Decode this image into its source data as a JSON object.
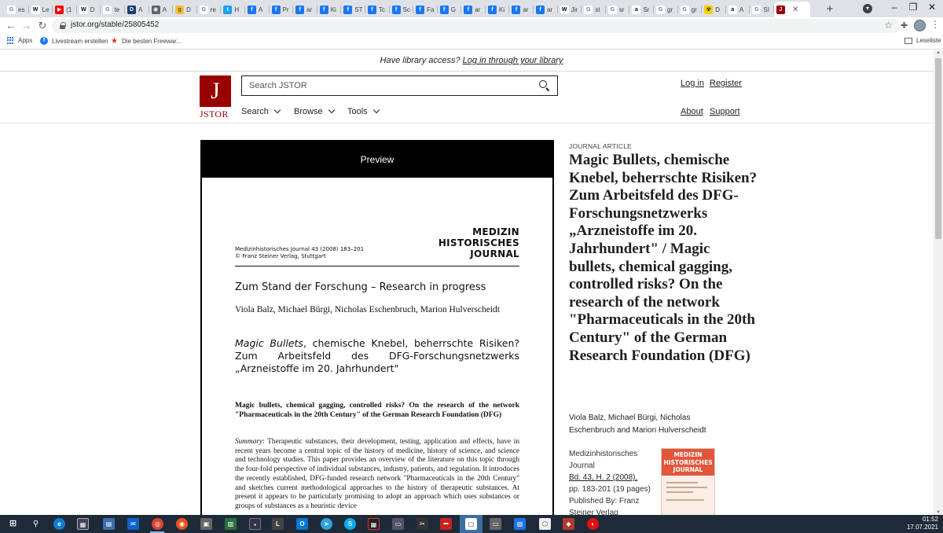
{
  "browser": {
    "tabs": [
      {
        "label": "es",
        "icon": "google-icon",
        "color": "#ffffff",
        "glyph": "G",
        "fg": "#4285f4"
      },
      {
        "label": "Le",
        "icon": "wikipedia-icon",
        "color": "#ffffff",
        "glyph": "W",
        "fg": "#000000"
      },
      {
        "label": "(1",
        "icon": "youtube-icon",
        "color": "#ff0000",
        "glyph": "▶",
        "fg": "#ffffff"
      },
      {
        "label": "D",
        "icon": "wikipedia-icon",
        "color": "#ffffff",
        "glyph": "W",
        "fg": "#000000"
      },
      {
        "label": "te",
        "icon": "google-icon",
        "color": "#ffffff",
        "glyph": "G",
        "fg": "#4285f4"
      },
      {
        "label": "A",
        "icon": "doc-icon",
        "color": "#1a3a6b",
        "glyph": "D",
        "fg": "#ffffff"
      },
      {
        "label": "A",
        "icon": "globe-icon",
        "color": "#5f6368",
        "glyph": "◉",
        "fg": "#ffffff"
      },
      {
        "label": "D",
        "icon": "site-icon",
        "color": "#f0c040",
        "glyph": "g",
        "fg": "#6b4a00"
      },
      {
        "label": "re",
        "icon": "google-icon",
        "color": "#ffffff",
        "glyph": "G",
        "fg": "#4285f4"
      },
      {
        "label": "H",
        "icon": "twitter-icon",
        "color": "#1da1f2",
        "glyph": "t",
        "fg": "#ffffff"
      },
      {
        "label": "A",
        "icon": "facebook-icon",
        "color": "#1877f2",
        "glyph": "f",
        "fg": "#ffffff"
      },
      {
        "label": "Pr",
        "icon": "facebook-icon",
        "color": "#1877f2",
        "glyph": "f",
        "fg": "#ffffff"
      },
      {
        "label": "ar",
        "icon": "facebook-icon",
        "color": "#1877f2",
        "glyph": "f",
        "fg": "#ffffff"
      },
      {
        "label": "Ki",
        "icon": "facebook-icon",
        "color": "#1877f2",
        "glyph": "f",
        "fg": "#ffffff"
      },
      {
        "label": "ST",
        "icon": "facebook-icon",
        "color": "#1877f2",
        "glyph": "f",
        "fg": "#ffffff"
      },
      {
        "label": "Tc",
        "icon": "facebook-icon",
        "color": "#1877f2",
        "glyph": "f",
        "fg": "#ffffff"
      },
      {
        "label": "Sc",
        "icon": "facebook-icon",
        "color": "#1877f2",
        "glyph": "f",
        "fg": "#ffffff"
      },
      {
        "label": "Fa",
        "icon": "facebook-icon",
        "color": "#1877f2",
        "glyph": "f",
        "fg": "#ffffff"
      },
      {
        "label": "G",
        "icon": "facebook-icon",
        "color": "#1877f2",
        "glyph": "f",
        "fg": "#ffffff"
      },
      {
        "label": "ar",
        "icon": "facebook-icon",
        "color": "#1877f2",
        "glyph": "f",
        "fg": "#ffffff"
      },
      {
        "label": "Ki",
        "icon": "facebook-icon",
        "color": "#1877f2",
        "glyph": "f",
        "fg": "#ffffff"
      },
      {
        "label": "ar",
        "icon": "facebook-icon",
        "color": "#1877f2",
        "glyph": "f",
        "fg": "#ffffff"
      },
      {
        "label": "ar",
        "icon": "facebook-icon",
        "color": "#1877f2",
        "glyph": "f",
        "fg": "#ffffff"
      },
      {
        "label": "Jir",
        "icon": "wikipedia-icon",
        "color": "#ffffff",
        "glyph": "W",
        "fg": "#000000"
      },
      {
        "label": "st",
        "icon": "google-icon",
        "color": "#ffffff",
        "glyph": "G",
        "fg": "#4285f4"
      },
      {
        "label": "sr",
        "icon": "google-icon",
        "color": "#ffffff",
        "glyph": "G",
        "fg": "#4285f4"
      },
      {
        "label": "Sr",
        "icon": "amazon-icon",
        "color": "#ffffff",
        "glyph": "a",
        "fg": "#111111"
      },
      {
        "label": "gr",
        "icon": "google-icon",
        "color": "#ffffff",
        "glyph": "G",
        "fg": "#4285f4"
      },
      {
        "label": "gr",
        "icon": "google-icon",
        "color": "#ffffff",
        "glyph": "G",
        "fg": "#4285f4"
      },
      {
        "label": "D",
        "icon": "radiation-icon",
        "color": "#f5d000",
        "glyph": "☢",
        "fg": "#111111"
      },
      {
        "label": "A",
        "icon": "amazon-icon",
        "color": "#ffffff",
        "glyph": "a",
        "fg": "#111111"
      },
      {
        "label": "SI",
        "icon": "google-icon",
        "color": "#ffffff",
        "glyph": "G",
        "fg": "#4285f4"
      }
    ],
    "active_tab": {
      "icon": "jstor-icon",
      "color": "#990000",
      "glyph": "J",
      "fg": "#ffffff",
      "close": "✕"
    },
    "new_tab": "+",
    "url": "jstor.org/stable/25805452",
    "bookmarks": {
      "apps": "Apps",
      "item1": "Livestream erstellen",
      "item2": "Die besten Freewar...",
      "reading_list": "Leseliste"
    }
  },
  "page": {
    "access_prompt": "Have library access?",
    "access_link": "Log in through your library",
    "logo_text": "JSTOR",
    "search_placeholder": "Search JSTOR",
    "nav": {
      "search": "Search",
      "browse": "Browse",
      "tools": "Tools"
    },
    "login": "Log in",
    "register": "Register",
    "about": "About",
    "support": "Support",
    "preview": {
      "header": "Preview",
      "journal_name_1": "MEDIZIN",
      "journal_name_2": "HISTORISCHES",
      "journal_name_3": "JOURNAL",
      "cite_line_1": "Medizinhistorisches Journal 43 (2008) 183–201",
      "cite_line_2": "© Franz Steiner Verlag, Stuttgart",
      "section": "Zum Stand der Forschung – Research in progress",
      "authors": "Viola Balz, Michael Bürgi, Nicholas Eschenbruch, Marion Hulverscheidt",
      "title_em": "Magic Bullets",
      "title_rest": ", chemische Knebel, beherrschte Risiken? Zum Arbeitsfeld des DFG-Forschungsnetzwerks „Arzneistoffe im 20. Jahrhundert\"",
      "en_title": "Magic bullets, chemical gagging, controlled risks? On the research of the network \"Pharmaceuticals in the 20th Century\" of the German Research Foundation (DFG)",
      "summary_label": "Summary",
      "summary": ": Therapeutic substances, their development, testing, application and effects, have in recent years become a central topic of the history of medicine, history of science, and science and technology studies. This paper provides an overview of the literature on this topic through the four-fold perspective of individual substances, industry, patients, and regulation. It introduces the recently established, DFG-funded research network \"Pharmaceuticals in the 20th Century\" and sketches current methodological approaches to the history of therapeutic substances. At present it appears to be particularly promising to adopt an approach which uses substances or groups of substances as a heuristic device"
    },
    "article": {
      "kicker": "JOURNAL ARTICLE",
      "title": "Magic Bullets, chemische Knebel, beherrschte Risiken? Zum Arbeitsfeld des DFG-Forschungsnetzwerks „Arzneistoffe im 20. Jahrhundert\" / Magic bullets, chemical gagging, controlled risks? On the research of the network \"Pharmaceuticals in the 20th Century\" of the German Research Foundation (DFG)",
      "authors": "Viola Balz, Michael Bürgi, Nicholas Eschenbruch and Marion Hulverscheidt",
      "journal": "Medizinhistorisches Journal",
      "issue_link": "Bd. 43, H. 2 (2008),",
      "pages": "pp. 183-201 (19 pages)",
      "published_by": "Published By: Franz Steiner Verlag",
      "cover_text": "MEDIZIN HISTORISCHES JOURNAL"
    }
  },
  "taskbar": {
    "time": "01:52",
    "date": "17.07.2021"
  }
}
